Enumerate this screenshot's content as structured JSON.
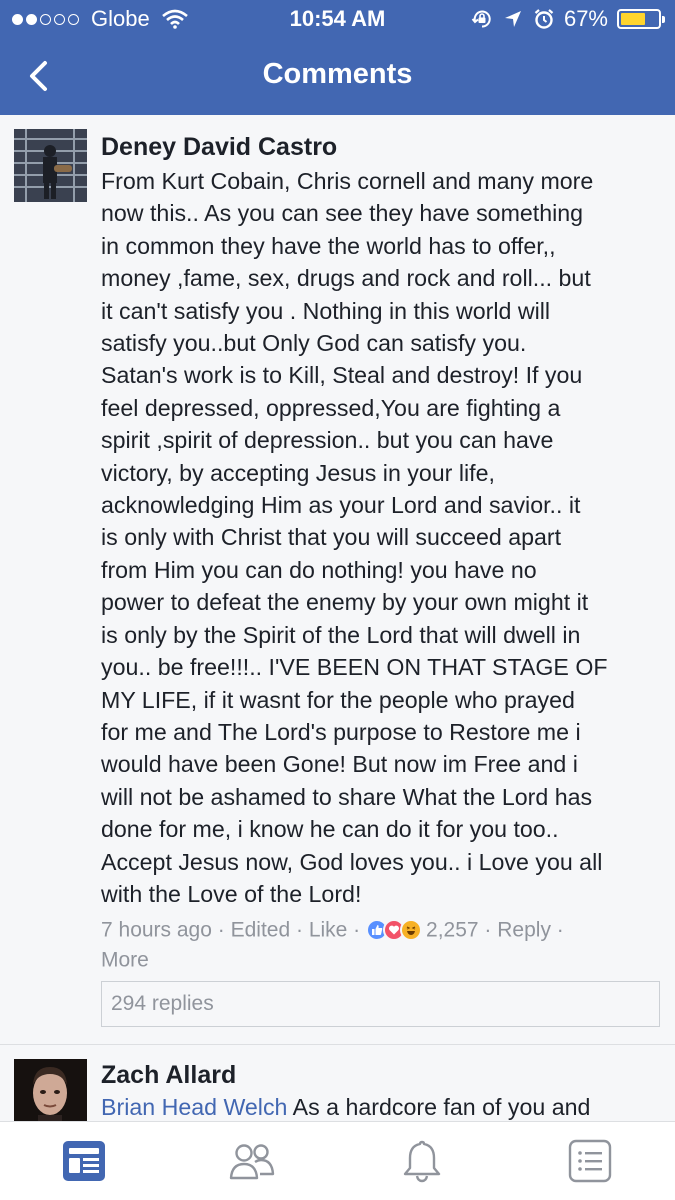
{
  "status_bar": {
    "carrier": "Globe",
    "time": "10:54 AM",
    "battery": "67%",
    "battery_level": 0.67
  },
  "nav": {
    "title": "Comments"
  },
  "comments": [
    {
      "author": "Deney David Castro",
      "text": "From Kurt Cobain, Chris cornell and many more\nnow this.. As you can see they have something\nin common they have the world has to offer,,\nmoney ,fame, sex, drugs and rock and roll... but\nit can't satisfy you . Nothing in this world will\nsatisfy you..but Only God can satisfy you.\nSatan's work is to Kill, Steal and destroy! If you\nfeel depressed, oppressed,You are fighting a\nspirit ,spirit of depression.. but you can have\nvictory, by accepting Jesus in your life,\nacknowledging Him as your Lord and savior.. it\nis only with Christ that you will succeed apart\nfrom Him you can do nothing! you have no\npower to defeat the enemy by your own might it\nis only by the Spirit of the Lord that will dwell in\nyou.. be free!!!.. I'VE BEEN ON THAT STAGE OF\nMY LIFE, if it wasnt for the people who prayed\nfor me and The Lord's purpose to Restore me i\nwould have been Gone! But now im Free and i\nwill not be ashamed to share What the Lord has\ndone for me, i know he can do it for you too..\nAccept Jesus now, God loves you.. i Love you all\nwith the Love of the Lord!",
      "time": "7 hours ago",
      "separator": " · ",
      "edited": "Edited",
      "like": "Like",
      "reaction_count": "2,257",
      "reply": "Reply",
      "more": "More",
      "replies": "294 replies"
    },
    {
      "author": "Zach Allard",
      "mention": "Brian Head Welch",
      "text": " As a hardcore fan of you and"
    }
  ],
  "tabbar": {
    "tabs": [
      "news-feed",
      "friends",
      "notifications",
      "menu"
    ],
    "active_color": "#4267b2",
    "inactive_color": "#90949c"
  }
}
